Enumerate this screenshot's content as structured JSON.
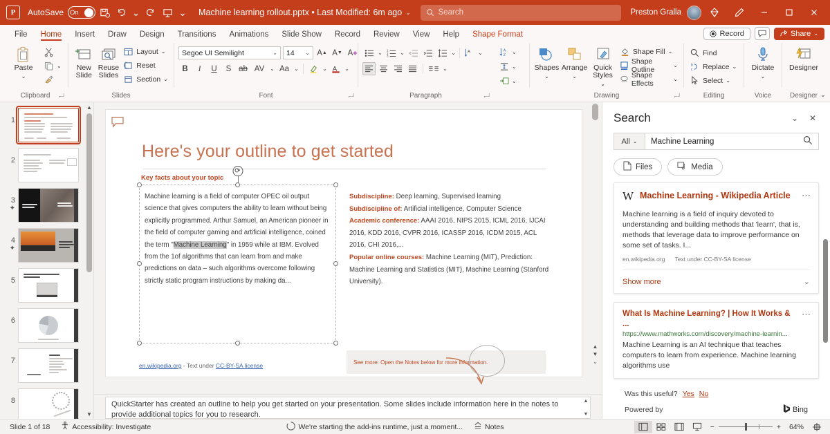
{
  "titlebar": {
    "app_logo": "powerpoint-logo",
    "autosave_label": "AutoSave",
    "autosave_state": "On",
    "doc_title": "Machine learning rollout.pptx  •  Last Modified: 6m ago",
    "search_placeholder": "Search",
    "user_name": "Preston Gralla",
    "icons": [
      "save-icon",
      "undo-icon",
      "redo-icon",
      "present-icon",
      "more-commands-icon"
    ],
    "window_buttons": [
      "minimize",
      "restore",
      "close"
    ],
    "accent": "#c43e1c"
  },
  "ribbon_tabs": {
    "tabs": [
      "File",
      "Home",
      "Insert",
      "Draw",
      "Design",
      "Transitions",
      "Animations",
      "Slide Show",
      "Record",
      "Review",
      "View",
      "Help"
    ],
    "active": "Home",
    "context_tab": "Shape Format",
    "record_label": "Record",
    "share_label": "Share"
  },
  "ribbon": {
    "groups": [
      {
        "label": "Clipboard",
        "big": [
          {
            "label": "Paste",
            "icon": "paste-icon"
          }
        ],
        "small": [
          {
            "label": "",
            "icon": "cut-icon"
          },
          {
            "label": "",
            "icon": "copy-icon"
          },
          {
            "label": "",
            "icon": "format-painter-icon"
          }
        ]
      },
      {
        "label": "Slides",
        "big": [
          {
            "label": "New Slide",
            "icon": "new-slide-icon"
          },
          {
            "label": "Reuse Slides",
            "icon": "reuse-slides-icon"
          }
        ],
        "small": [
          {
            "label": "Layout",
            "icon": "layout-icon"
          },
          {
            "label": "Reset",
            "icon": "reset-icon"
          },
          {
            "label": "Section",
            "icon": "section-icon"
          }
        ]
      },
      {
        "label": "Font",
        "font_name": "Segoe UI Semilight",
        "font_size": "14",
        "row1": [
          "grow-font-icon",
          "shrink-font-icon",
          "clear-formatting-icon"
        ],
        "row2": [
          "bold-icon",
          "italic-icon",
          "underline-icon",
          "shadow-icon",
          "strikethrough-icon",
          "character-spacing-icon",
          "change-case-icon",
          "text-highlight-icon",
          "font-color-icon"
        ]
      },
      {
        "label": "Paragraph",
        "row1": [
          "bullets-icon",
          "numbering-icon",
          "decrease-indent-icon",
          "increase-indent-icon",
          "line-spacing-icon",
          "text-direction-icon"
        ],
        "row2": [
          "align-left-icon",
          "align-center-icon",
          "align-right-icon",
          "justify-icon",
          "columns-icon",
          "align-text-icon",
          "convert-to-smartart-icon"
        ]
      },
      {
        "label": "Drawing",
        "big": [
          {
            "label": "Shapes",
            "icon": "shapes-icon"
          },
          {
            "label": "Arrange",
            "icon": "arrange-icon"
          },
          {
            "label": "Quick Styles",
            "icon": "quick-styles-icon"
          }
        ],
        "small": [
          {
            "label": "Shape Fill",
            "icon": "shape-fill-icon"
          },
          {
            "label": "Shape Outline",
            "icon": "shape-outline-icon"
          },
          {
            "label": "Shape Effects",
            "icon": "shape-effects-icon"
          }
        ]
      },
      {
        "label": "Editing",
        "small": [
          {
            "label": "Find",
            "icon": "find-icon"
          },
          {
            "label": "Replace",
            "icon": "replace-icon"
          },
          {
            "label": "Select",
            "icon": "select-icon"
          }
        ]
      },
      {
        "label": "Voice",
        "big": [
          {
            "label": "Dictate",
            "icon": "microphone-icon"
          }
        ]
      },
      {
        "label": "Designer",
        "big": [
          {
            "label": "Designer",
            "icon": "designer-icon"
          }
        ]
      }
    ]
  },
  "thumbnails": {
    "items": [
      {
        "number": "1",
        "starred": false,
        "selected": true,
        "style": "outline"
      },
      {
        "number": "2",
        "starred": false,
        "selected": false,
        "style": "outline2"
      },
      {
        "number": "3",
        "starred": true,
        "selected": false,
        "style": "dark-photo"
      },
      {
        "number": "4",
        "starred": true,
        "selected": false,
        "style": "sunset-photo"
      },
      {
        "number": "5",
        "starred": false,
        "selected": false,
        "style": "text-image"
      },
      {
        "number": "6",
        "starred": false,
        "selected": false,
        "style": "pie-chart"
      },
      {
        "number": "7",
        "starred": false,
        "selected": false,
        "style": "content-list"
      },
      {
        "number": "8",
        "starred": false,
        "selected": false,
        "style": "diagram"
      }
    ]
  },
  "slide": {
    "title": "Here's your outline to get started",
    "section_label": "Key facts about your topic",
    "body_parts": [
      "Machine learning is a field of computer OPEC oil output science that gives computers the ability to learn without being explicitly programmed. Arthur Samuel, an American pioneer in the field of computer gaming and artificial intelligence, coined the term \"",
      "Machine Learning",
      "\" in 1959 while at IBM. Evolved from the 1of algorithms that can learn from and make predictions on data – such algorithms overcome following strictly static program instructions by making da..."
    ],
    "facts": [
      {
        "label": "Subdiscipline:",
        "value": " Deep learning, Supervised learning"
      },
      {
        "label": "Subdiscipline of:",
        "value": " Artificial intelligence, Computer Science"
      },
      {
        "label": "Academic conference:",
        "value": " AAAI 2016, NIPS 2015, ICML 2016, IJCAI 2016, KDD 2016, CVPR 2016, ICASSP 2016, ICDM 2015, ACL 2016, CHI 2016,..."
      },
      {
        "label": "Popular online courses:",
        "value": " Machine Learning (MIT), Prediction: Machine Learning and Statistics (MIT), Machine Learning (Stanford University)."
      }
    ],
    "source_link": "en.wikipedia.org",
    "source_mid": " - Text under ",
    "source_license": "CC-BY-SA license",
    "notes_hint": "See more: Open the Notes below for more information.",
    "notes_button": "Notes"
  },
  "notes_pane": {
    "text": "QuickStarter has created an outline to help you get started on your presentation. Some slides include information here in the notes to provide additional topics for you to research."
  },
  "search_panel": {
    "title": "Search",
    "filter_label": "All",
    "query": "Machine Learning",
    "pills": [
      {
        "label": "Files",
        "icon": "file-icon"
      },
      {
        "label": "Media",
        "icon": "media-icon"
      }
    ],
    "results": [
      {
        "source_icon": "wikipedia-w-icon",
        "title": "Machine Learning - Wikipedia Article",
        "description": "Machine learning is a field of inquiry devoted to understanding and building methods that 'learn', that is, methods that leverage data to improve performance on some set of tasks. I...",
        "meta_domain": "en.wikipedia.org",
        "meta_license": "Text under CC-BY-SA license",
        "show_more": "Show more"
      },
      {
        "title": "What Is Machine Learning? | How It Works & ...",
        "url": "https://www.mathworks.com/discovery/machine-learnin...",
        "description": "Machine Learning is an AI technique that teaches computers to learn from experience. Machine learning algorithms use"
      }
    ],
    "feedback_question": "Was this useful?",
    "feedback_yes": "Yes",
    "feedback_no": "No",
    "powered_by": "Powered by",
    "powered_by_brand": "Bing"
  },
  "statusbar": {
    "slide_count": "Slide 1 of 18",
    "accessibility": "Accessibility: Investigate",
    "addin_message": "We're starting the add-ins runtime, just a moment...",
    "notes_label": "Notes",
    "views": [
      "normal-view-icon",
      "slide-sorter-icon",
      "reading-view-icon",
      "slide-show-icon"
    ],
    "active_view": "normal-view-icon",
    "zoom_out": "−",
    "zoom_in": "+",
    "zoom_level": "64%",
    "fit_icon": "fit-to-window-icon"
  }
}
